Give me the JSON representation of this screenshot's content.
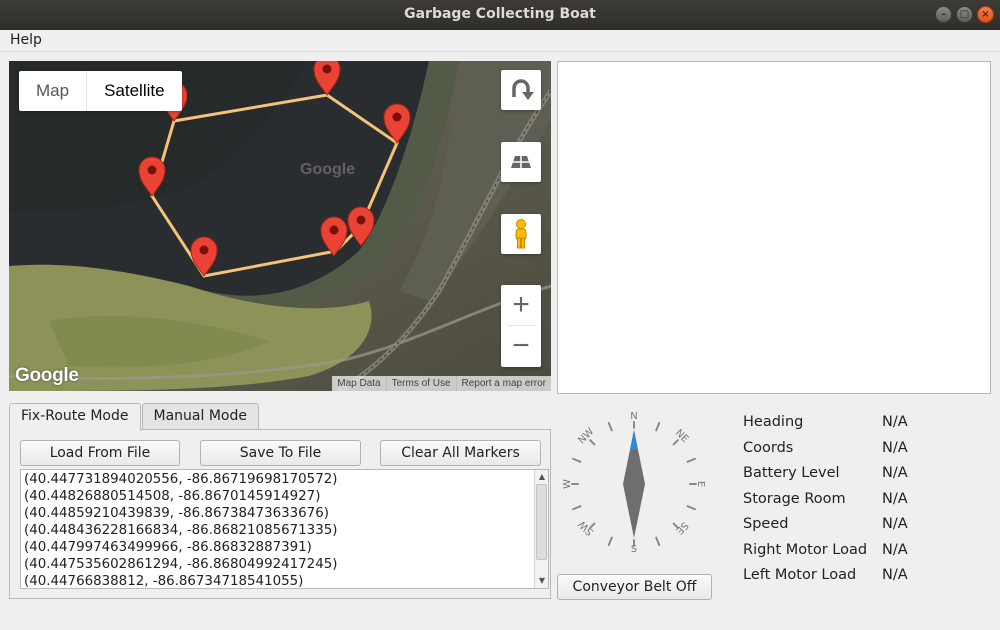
{
  "window": {
    "title": "Garbage Collecting Boat"
  },
  "menu": {
    "help": "Help"
  },
  "map": {
    "type_map": "Map",
    "type_satellite": "Satellite",
    "google_logo": "Google",
    "watermark": "Google",
    "footer": [
      "Map Data",
      "Terms of Use",
      "Report a map error"
    ],
    "zoom_in": "+",
    "zoom_out": "−"
  },
  "tabs": {
    "fix_route": "Fix-Route Mode",
    "manual": "Manual Mode"
  },
  "buttons": {
    "load": "Load From File",
    "save": "Save To File",
    "clear": "Clear All Markers",
    "conveyor": "Conveyor Belt Off"
  },
  "coords": [
    "(40.447731894020556, -86.86719698170572)",
    "(40.44826880514508, -86.8670145914927)",
    "(40.44859210439839, -86.86738473633676)",
    "(40.448436228166834, -86.86821085671335)",
    "(40.447997463499966, -86.86832887391)",
    "(40.447535602861294, -86.86804992417245)",
    "(40.44766838812, -86.86734718541055)"
  ],
  "compass": {
    "n": "N",
    "s": "S",
    "e": "E",
    "w": "W",
    "ne": "NE",
    "nw": "NW",
    "se": "SE",
    "sw": "SW"
  },
  "telemetry": [
    {
      "label": "Heading",
      "value": "N/A"
    },
    {
      "label": "Coords",
      "value": "N/A"
    },
    {
      "label": "Battery Level",
      "value": "N/A"
    },
    {
      "label": "Storage Room",
      "value": "N/A"
    },
    {
      "label": "Speed",
      "value": "N/A"
    },
    {
      "label": "Right Motor Load",
      "value": "N/A"
    },
    {
      "label": "Left Motor Load",
      "value": "N/A"
    }
  ],
  "colors": {
    "route": "#f5c27a",
    "marker": "#ea4335",
    "compass_needle_north": "#2f86d6"
  }
}
